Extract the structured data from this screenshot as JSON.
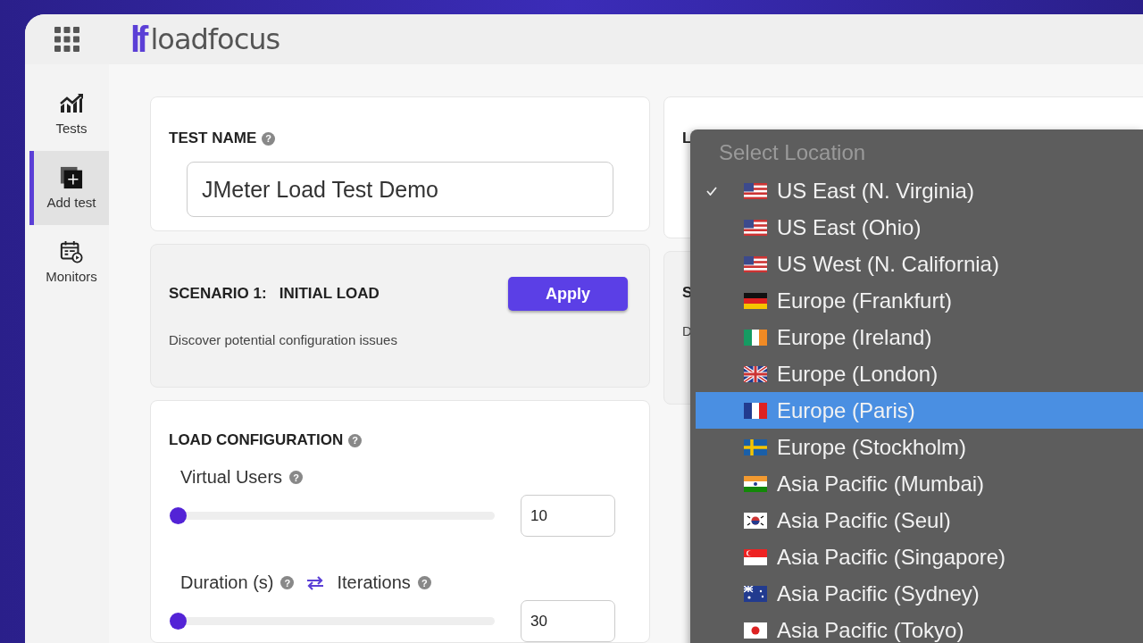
{
  "logo": {
    "mark": "lf",
    "text": "loadfocus"
  },
  "sidebar": {
    "items": [
      {
        "label": "Tests",
        "kind": "chart",
        "selected": false
      },
      {
        "label": "Add test",
        "kind": "add",
        "selected": true
      },
      {
        "label": "Monitors",
        "kind": "calendar",
        "selected": false
      }
    ]
  },
  "test_name": {
    "title": "TEST NAME",
    "help": "?",
    "value": "JMeter Load Test Demo"
  },
  "scenario": {
    "title": "SCENARIO 1:   INITIAL LOAD",
    "button": "Apply",
    "description": "Discover potential configuration issues"
  },
  "load_configuration": {
    "title": "LOAD CONFIGURATION",
    "help": "?",
    "sliders": [
      {
        "labels": [
          {
            "text": "Virtual Users",
            "help": "?"
          }
        ],
        "level": 0,
        "value": "10"
      },
      {
        "labels": [
          {
            "text": "Duration (s)",
            "help": "?"
          },
          {
            "text": "Iterations",
            "help": "?"
          }
        ],
        "level": 0,
        "value": "30"
      }
    ]
  },
  "location_card": {
    "title": "L"
  },
  "scenario_2": {
    "title": "S",
    "description": "D"
  },
  "location_dropdown": {
    "placeholder": "Select Location",
    "options": [
      {
        "label": "US East (N. Virginia)",
        "kind": "us",
        "checked": true,
        "selected": false
      },
      {
        "label": "US East (Ohio)",
        "kind": "us",
        "checked": false,
        "selected": false
      },
      {
        "label": "US West (N. California)",
        "kind": "us",
        "checked": false,
        "selected": false
      },
      {
        "label": "Europe (Frankfurt)",
        "kind": "de",
        "checked": false,
        "selected": false
      },
      {
        "label": "Europe (Ireland)",
        "kind": "ie",
        "checked": false,
        "selected": false
      },
      {
        "label": "Europe (London)",
        "kind": "gb",
        "checked": false,
        "selected": false
      },
      {
        "label": "Europe (Paris)",
        "kind": "fr",
        "checked": false,
        "selected": true
      },
      {
        "label": "Europe (Stockholm)",
        "kind": "se",
        "checked": false,
        "selected": false
      },
      {
        "label": "Asia Pacific (Mumbai)",
        "kind": "in",
        "checked": false,
        "selected": false
      },
      {
        "label": "Asia Pacific (Seul)",
        "kind": "kr",
        "checked": false,
        "selected": false
      },
      {
        "label": "Asia Pacific (Singapore)",
        "kind": "sg",
        "checked": false,
        "selected": false
      },
      {
        "label": "Asia Pacific (Sydney)",
        "kind": "au",
        "checked": false,
        "selected": false
      },
      {
        "label": "Asia Pacific (Tokyo)",
        "kind": "jp",
        "checked": false,
        "selected": false
      }
    ]
  }
}
